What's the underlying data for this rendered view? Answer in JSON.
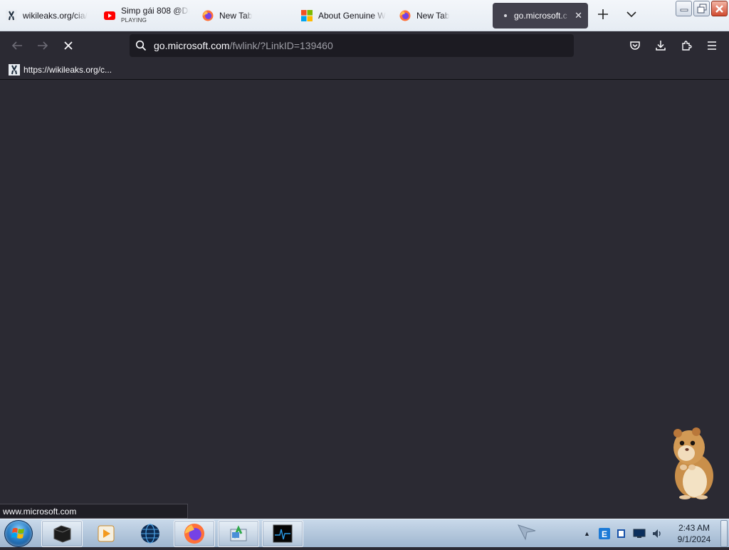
{
  "tabs": [
    {
      "label": "wikileaks.org/cia/",
      "icon": "wikileaks-favicon-icon"
    },
    {
      "label": "Simp gái 808 @Dr",
      "sublabel": "PLAYING",
      "icon": "youtube-icon"
    },
    {
      "label": "New Tab",
      "icon": "firefox-icon"
    },
    {
      "label": "About Genuine W",
      "icon": "microsoft-logo-icon"
    },
    {
      "label": "New Tab",
      "icon": "firefox-icon"
    },
    {
      "label": "go.microsoft.c",
      "icon": "loading-dot-icon",
      "active": true
    }
  ],
  "nav": {
    "url_host": "go.microsoft.com",
    "url_path": "/fwlink/?LinkID=139460"
  },
  "bookmarks": [
    {
      "label": "https://wikileaks.org/c...",
      "icon": "wikileaks-favicon-icon"
    }
  ],
  "status": {
    "text": "www.microsoft.com"
  },
  "clock": {
    "time": "2:43 AM",
    "date": "9/1/2024"
  },
  "colors": {
    "toolbar": "#2b2a33",
    "urlbar": "#1c1b22",
    "active_tab": "#42414d",
    "accent_youtube": "#ff0000",
    "taskbar": "#b4c8dd"
  }
}
